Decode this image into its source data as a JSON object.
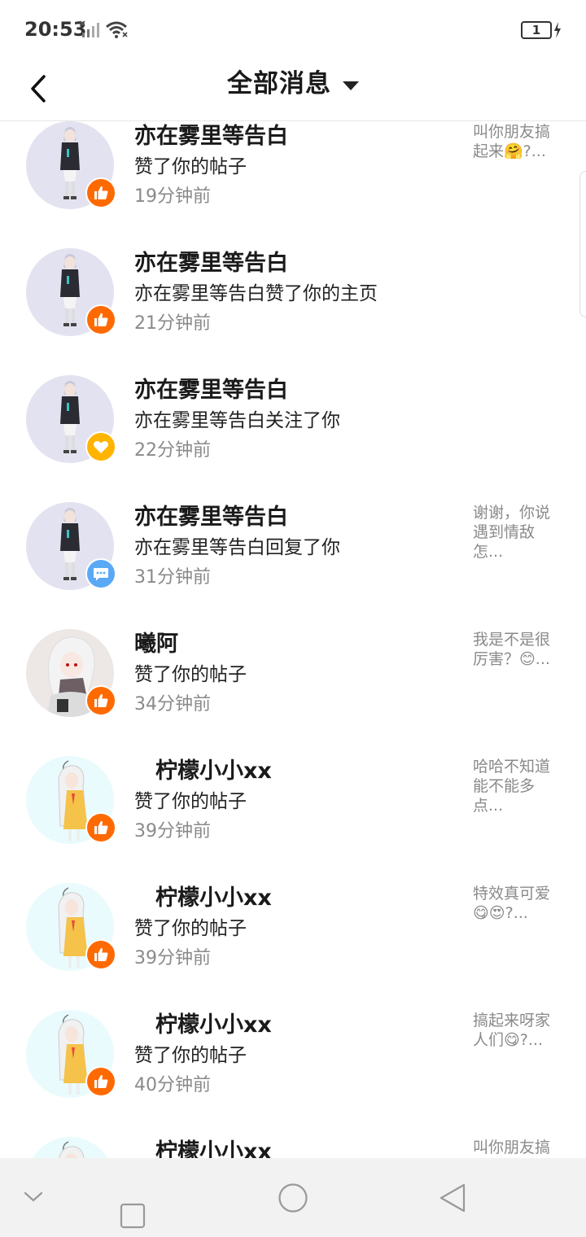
{
  "status_bar": {
    "time": "20:53",
    "battery": "1",
    "icons": [
      "signal-icon",
      "wifi-icon",
      "battery-icon",
      "charging-icon"
    ]
  },
  "header": {
    "title": "全部消息",
    "back_icon": "chevron-left-icon",
    "dropdown_icon": "caret-down-icon"
  },
  "colors": {
    "like_badge": "#ff6a00",
    "follow_badge": "#ffb400",
    "reply_badge": "#5aa9f5",
    "secondary_text": "#8a8a8a"
  },
  "messages": [
    {
      "sender": "亦在雾里等告白",
      "action": "赞了你的帖子",
      "time": "19分钟前",
      "preview": "叫你朋友搞起来🤗?...",
      "badge": "like-icon",
      "avatar": "avatar-dark"
    },
    {
      "sender": "亦在雾里等告白",
      "action": "亦在雾里等告白赞了你的主页",
      "time": "21分钟前",
      "preview": "",
      "badge": "like-icon",
      "avatar": "avatar-dark"
    },
    {
      "sender": "亦在雾里等告白",
      "action": "亦在雾里等告白关注了你",
      "time": "22分钟前",
      "preview": "",
      "badge": "heart-icon",
      "avatar": "avatar-dark"
    },
    {
      "sender": "亦在雾里等告白",
      "action": "亦在雾里等告白回复了你",
      "time": "31分钟前",
      "preview": "谢谢，你说遇到情敌怎...",
      "badge": "chat-icon",
      "avatar": "avatar-dark"
    },
    {
      "sender": "曦阿",
      "action": "赞了你的帖子",
      "time": "34分钟前",
      "preview": "我是不是很厉害？😊...",
      "badge": "like-icon",
      "avatar": "avatar-white"
    },
    {
      "sender": "柠檬小小xx",
      "action": "赞了你的帖子",
      "time": "39分钟前",
      "preview": "哈哈不知道能不能多点...",
      "badge": "like-icon",
      "avatar": "avatar-yellow"
    },
    {
      "sender": "柠檬小小xx",
      "action": "赞了你的帖子",
      "time": "39分钟前",
      "preview": "特效真可爱😋😍?...",
      "badge": "like-icon",
      "avatar": "avatar-yellow"
    },
    {
      "sender": "柠檬小小xx",
      "action": "赞了你的帖子",
      "time": "40分钟前",
      "preview": "搞起来呀家人们😋?...",
      "badge": "like-icon",
      "avatar": "avatar-yellow"
    },
    {
      "sender": "柠檬小小xx",
      "action": "",
      "time": "",
      "preview": "叫你朋友搞",
      "badge": "",
      "avatar": "avatar-yellow"
    }
  ],
  "nav_bar": {
    "icons": [
      "collapse-icon",
      "recents-icon",
      "home-icon",
      "back-icon"
    ]
  }
}
